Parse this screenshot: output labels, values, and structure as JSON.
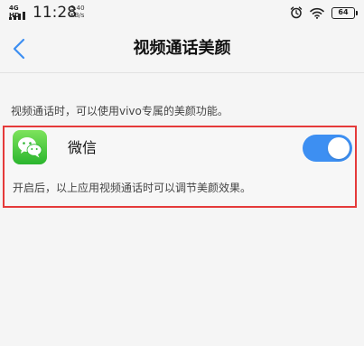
{
  "status_bar": {
    "network": "4G HD",
    "time": "11:28",
    "speed_value": "3.40",
    "speed_unit": "KB/s",
    "battery": "64"
  },
  "nav": {
    "title": "视频通话美颜"
  },
  "description": "视频通话时，可以使用vivo专属的美颜功能。",
  "app": {
    "name": "微信",
    "toggle_state": "on",
    "hint": "开启后，以上应用视频通话时可以调节美颜效果。"
  },
  "colors": {
    "accent": "#3d8ff2",
    "highlight_border": "#e53a3a",
    "wechat_green": "#2bb52e"
  },
  "icons": {
    "back": "chevron-left-icon",
    "alarm": "alarm-clock-icon",
    "wifi": "wifi-icon",
    "battery": "battery-icon",
    "app": "wechat-icon"
  }
}
